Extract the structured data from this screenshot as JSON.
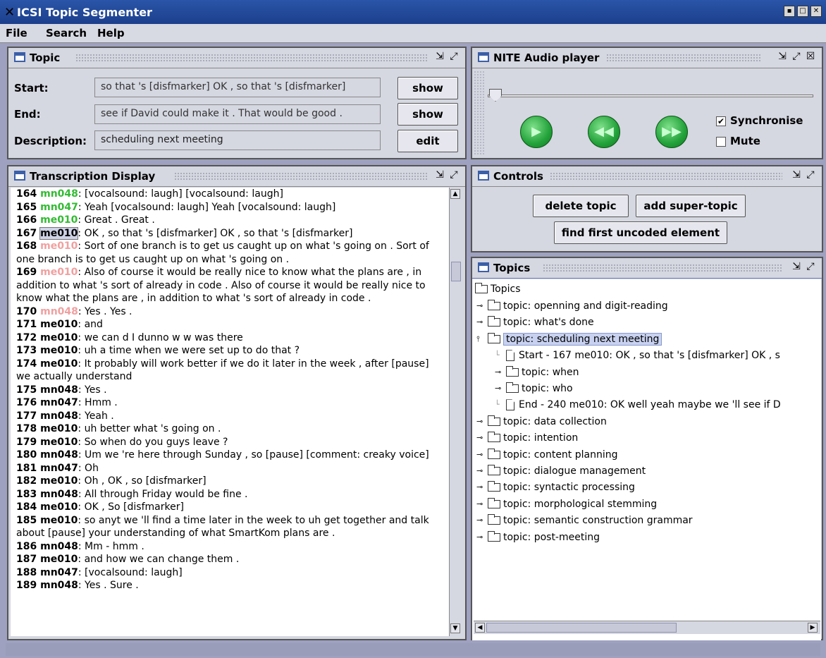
{
  "window": {
    "title": "ICSI Topic Segmenter"
  },
  "menu": [
    "File",
    "Search",
    "Help"
  ],
  "topic_panel": {
    "title": "Topic",
    "start_label": "Start:",
    "start_value": "so that 's [disfmarker] OK , so that 's [disfmarker]",
    "end_label": "End:",
    "end_value": "see if David could make it . That would be good .",
    "desc_label": "Description:",
    "desc_value": "scheduling next meeting",
    "show_label": "show",
    "edit_label": "edit"
  },
  "audio_panel": {
    "title": "NITE Audio player",
    "synchronise_label": "Synchronise",
    "synchronise_checked": true,
    "mute_label": "Mute",
    "mute_checked": false,
    "position": 0.0
  },
  "transcript_panel": {
    "title": "Transcription Display",
    "lines": [
      {
        "num": "164",
        "speaker": "mn048",
        "color": "#33bb33",
        "text": ": [vocalsound: laugh] [vocalsound: laugh]"
      },
      {
        "num": "165",
        "speaker": "mn047",
        "color": "#33bb33",
        "text": ": Yeah [vocalsound: laugh] Yeah [vocalsound: laugh]"
      },
      {
        "num": "166",
        "speaker": "me010",
        "color": "#33bb33",
        "text": ": Great . Great ."
      },
      {
        "num": "167",
        "speaker": "me010",
        "color": "#000000",
        "text": ": OK , so that 's [disfmarker] OK , so that 's [disfmarker]",
        "highlight": true
      },
      {
        "num": "168",
        "speaker": "me010",
        "color": "#f0a0a0",
        "text": ": Sort of one branch is to get us caught up on what 's going on . Sort of one branch is to get us caught up on what 's going on ."
      },
      {
        "num": "169",
        "speaker": "me010",
        "color": "#f0a0a0",
        "text": ": Also of course it would be really nice to know what the plans are , in addition to what 's sort of already in code . Also of course it would be really nice to know what the plans are , in addition to what 's sort of already in code ."
      },
      {
        "num": "170",
        "speaker": "mn048",
        "color": "#f0a0a0",
        "text": ": Yes . Yes ."
      },
      {
        "num": "171",
        "speaker": "me010",
        "color": "#000000",
        "text": ": and"
      },
      {
        "num": "172",
        "speaker": "me010",
        "color": "#000000",
        "text": ": we can d I dunno w w was there"
      },
      {
        "num": "173",
        "speaker": "me010",
        "color": "#000000",
        "text": ": uh a time when we were set up to do that ?"
      },
      {
        "num": "174",
        "speaker": "me010",
        "color": "#000000",
        "text": ": It probably will work better if we do it later in the week , after [pause] we actually understand"
      },
      {
        "num": "175",
        "speaker": "mn048",
        "color": "#000000",
        "text": ": Yes ."
      },
      {
        "num": "176",
        "speaker": "mn047",
        "color": "#000000",
        "text": ": Hmm ."
      },
      {
        "num": "177",
        "speaker": "mn048",
        "color": "#000000",
        "text": ": Yeah ."
      },
      {
        "num": "178",
        "speaker": "me010",
        "color": "#000000",
        "text": ": uh better what 's going on ."
      },
      {
        "num": "179",
        "speaker": "me010",
        "color": "#000000",
        "text": ": So when do you guys leave ?"
      },
      {
        "num": "180",
        "speaker": "mn048",
        "color": "#000000",
        "text": ": Um we 're here through Sunday , so [pause] [comment: creaky voice]"
      },
      {
        "num": "181",
        "speaker": "mn047",
        "color": "#000000",
        "text": ": Oh"
      },
      {
        "num": "182",
        "speaker": "me010",
        "color": "#000000",
        "text": ": Oh , OK , so [disfmarker]"
      },
      {
        "num": "183",
        "speaker": "mn048",
        "color": "#000000",
        "text": ": All through Friday would be fine ."
      },
      {
        "num": "184",
        "speaker": "me010",
        "color": "#000000",
        "text": ": OK , So [disfmarker]"
      },
      {
        "num": "185",
        "speaker": "me010",
        "color": "#000000",
        "text": ": so anyt we 'll find a time later in the week to uh get together and talk about [pause] your understanding of what SmartKom plans are ."
      },
      {
        "num": "186",
        "speaker": "mn048",
        "color": "#000000",
        "text": ": Mm - hmm ."
      },
      {
        "num": "187",
        "speaker": "me010",
        "color": "#000000",
        "text": ": and how we can change them ."
      },
      {
        "num": "188",
        "speaker": "mn047",
        "color": "#000000",
        "text": ": [vocalsound: laugh]"
      },
      {
        "num": "189",
        "speaker": "mn048",
        "color": "#000000",
        "text": ": Yes . Sure ."
      }
    ]
  },
  "controls_panel": {
    "title": "Controls",
    "delete_topic": "delete topic",
    "add_super_topic": "add super-topic",
    "find_first_uncoded": "find first uncoded element"
  },
  "topics_panel": {
    "title": "Topics",
    "root": "Topics",
    "nodes": [
      {
        "depth": 1,
        "kind": "folder",
        "expander": "closed",
        "label": "topic: openning and digit-reading"
      },
      {
        "depth": 1,
        "kind": "folder",
        "expander": "closed",
        "label": "topic: what's done"
      },
      {
        "depth": 1,
        "kind": "folder",
        "expander": "open",
        "label": "topic: scheduling next meeting",
        "selected": true
      },
      {
        "depth": 2,
        "kind": "doc",
        "expander": "none",
        "label": "Start - 167  me010: OK , so that 's [disfmarker] OK , s"
      },
      {
        "depth": 2,
        "kind": "folder",
        "expander": "closed",
        "label": "topic: when"
      },
      {
        "depth": 2,
        "kind": "folder",
        "expander": "closed",
        "label": "topic: who"
      },
      {
        "depth": 2,
        "kind": "doc",
        "expander": "none",
        "label": "End - 240  me010: OK well yeah maybe we 'll see if D"
      },
      {
        "depth": 1,
        "kind": "folder",
        "expander": "closed",
        "label": "topic: data collection"
      },
      {
        "depth": 1,
        "kind": "folder",
        "expander": "closed",
        "label": "topic: intention"
      },
      {
        "depth": 1,
        "kind": "folder",
        "expander": "closed",
        "label": "topic: content planning"
      },
      {
        "depth": 1,
        "kind": "folder",
        "expander": "closed",
        "label": "topic: dialogue management"
      },
      {
        "depth": 1,
        "kind": "folder",
        "expander": "closed",
        "label": "topic: syntactic processing"
      },
      {
        "depth": 1,
        "kind": "folder",
        "expander": "closed",
        "label": "topic: morphological stemming"
      },
      {
        "depth": 1,
        "kind": "folder",
        "expander": "closed",
        "label": "topic: semantic construction grammar"
      },
      {
        "depth": 1,
        "kind": "folder",
        "expander": "closed",
        "label": "topic: post-meeting"
      }
    ]
  },
  "colors": {
    "title_bar": "#1c3f8c",
    "panel_bg": "#d5d7e1",
    "speaker_green": "#33bb33",
    "speaker_pink": "#f0a0a0",
    "play_green": "#23a23a"
  },
  "icons": {
    "window": "x-logo-icon",
    "panel": "window-icon",
    "undock": "undock-icon",
    "maximize": "maximize-icon",
    "close": "close-icon",
    "play": "play-icon",
    "rewind": "rewind-icon",
    "forward": "fast-forward-icon"
  }
}
